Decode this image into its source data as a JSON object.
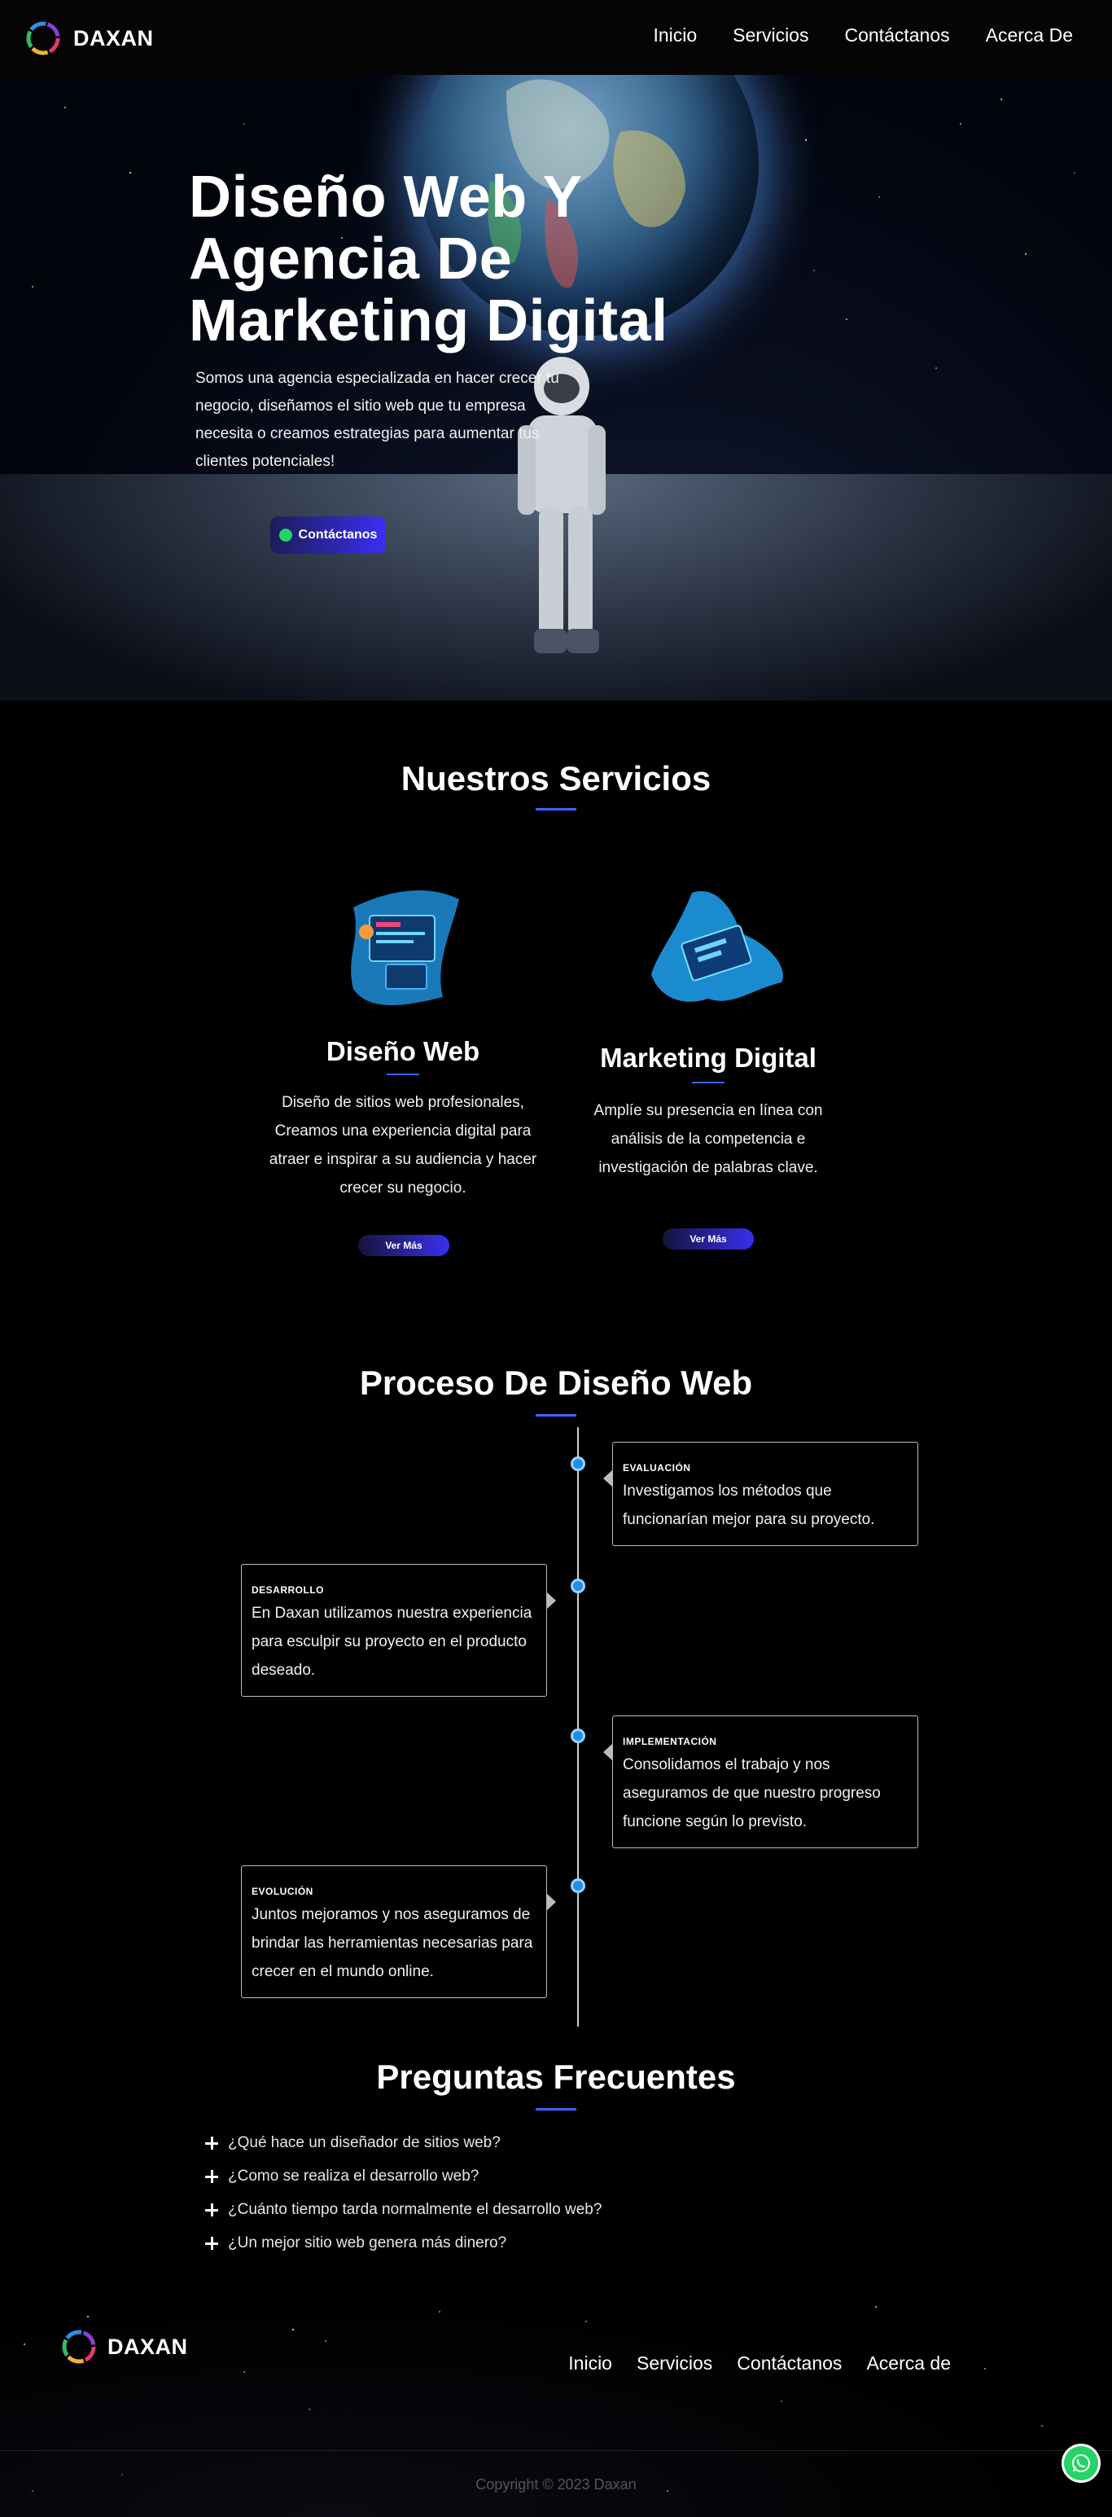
{
  "brand": {
    "name": "DAXAN"
  },
  "nav": {
    "items": [
      "Inicio",
      "Servicios",
      "Contáctanos",
      "Acerca De"
    ]
  },
  "hero": {
    "title_lines": [
      "Diseño Web Y",
      "Agencia De",
      "Marketing Digital"
    ],
    "text": "Somos una agencia especializada en hacer crecer tu negocio, diseñamos el sitio web que tu empresa necesita o creamos estrategias para aumentar tus clientes potenciales!",
    "cta_label": "Contáctanos"
  },
  "services": {
    "title": "Nuestros Servicios",
    "items": [
      {
        "title": "Diseño Web",
        "desc": "Diseño de sitios web profesionales, Creamos una experiencia digital para atraer e inspirar a su audiencia y hacer crecer su negocio.",
        "button": "Ver Más"
      },
      {
        "title": "Marketing Digital",
        "desc": "Amplíe su presencia en línea con análisis de la competencia e investigación de palabras clave.",
        "button": "Ver Más"
      }
    ]
  },
  "process": {
    "title": "Proceso De Diseño Web",
    "steps": [
      {
        "label": "EVALUACIÓN",
        "text": "Investigamos los métodos que funcionarían mejor para su proyecto."
      },
      {
        "label": "DESARROLLO",
        "text": "En Daxan utilizamos nuestra experiencia para esculpir su proyecto en el producto deseado."
      },
      {
        "label": "IMPLEMENTACIÓN",
        "text": "Consolidamos el trabajo y nos aseguramos de que nuestro progreso funcione según lo previsto."
      },
      {
        "label": "EVOLUCIÓN",
        "text": "Juntos mejoramos y nos aseguramos de brindar las herramientas necesarias para crecer en el mundo online."
      }
    ]
  },
  "faq": {
    "title": "Preguntas Frecuentes",
    "items": [
      "¿Qué hace un diseñador de sitios web?",
      "¿Como se realiza el desarrollo web?",
      "¿Cuánto tiempo tarda normalmente el desarrollo web?",
      "¿Un mejor sitio web genera más dinero?"
    ]
  },
  "footer": {
    "brand": "DAXAN",
    "nav": [
      "Inicio",
      "Servicios",
      "Contáctanos",
      "Acerca de"
    ],
    "copyright": "Copyright © 2023 Daxan"
  },
  "colors": {
    "accent": "#3a64ff",
    "button": "#3a2ff0",
    "whatsapp": "#25d366",
    "timeline_dot": "#1e8fe6"
  },
  "icons": {
    "whatsapp": "whatsapp-icon",
    "plus": "plus-icon",
    "logo": "daxan-logo-icon"
  }
}
